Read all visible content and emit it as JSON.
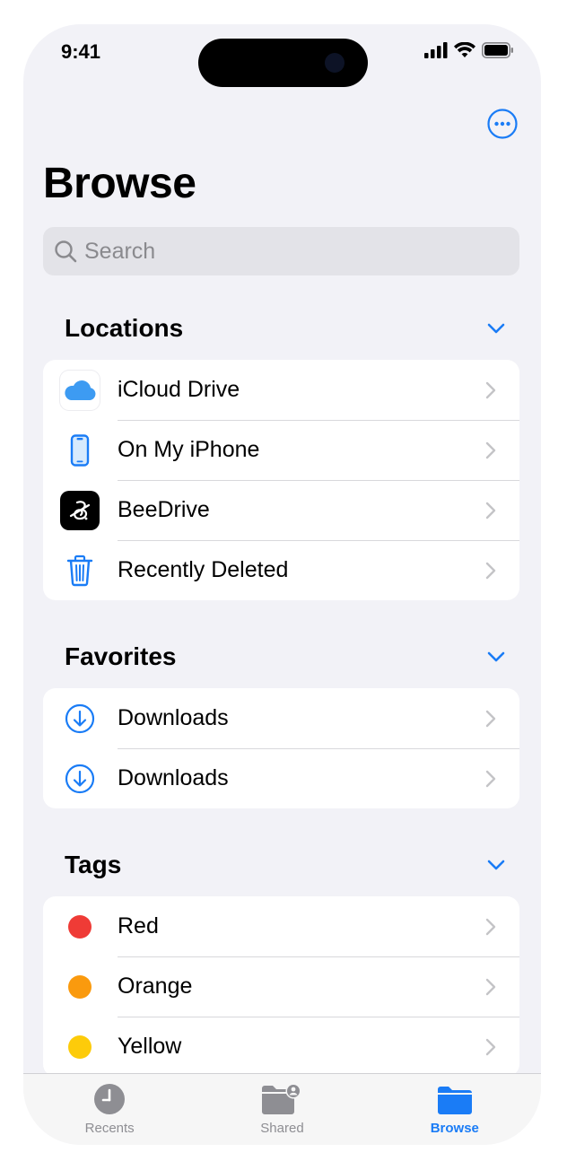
{
  "status_bar": {
    "time": "9:41"
  },
  "header": {
    "title": "Browse",
    "more_icon": "ellipsis-circle-icon"
  },
  "search": {
    "placeholder": "Search"
  },
  "sections": {
    "locations": {
      "title": "Locations",
      "items": [
        {
          "label": "iCloud Drive",
          "icon": "icloud-icon"
        },
        {
          "label": "On My iPhone",
          "icon": "iphone-icon"
        },
        {
          "label": "BeeDrive",
          "icon": "beedrive-icon"
        },
        {
          "label": "Recently Deleted",
          "icon": "trash-icon"
        }
      ]
    },
    "favorites": {
      "title": "Favorites",
      "items": [
        {
          "label": "Downloads",
          "icon": "download-circle-icon"
        },
        {
          "label": "Downloads",
          "icon": "download-circle-icon"
        }
      ]
    },
    "tags": {
      "title": "Tags",
      "items": [
        {
          "label": "Red",
          "color": "#ef3b36"
        },
        {
          "label": "Orange",
          "color": "#fa9a0e"
        },
        {
          "label": "Yellow",
          "color": "#fdcb0a"
        }
      ]
    }
  },
  "tab_bar": {
    "tabs": [
      {
        "label": "Recents",
        "icon": "clock-icon",
        "active": false
      },
      {
        "label": "Shared",
        "icon": "shared-folder-icon",
        "active": false
      },
      {
        "label": "Browse",
        "icon": "folder-icon",
        "active": true
      }
    ]
  },
  "colors": {
    "accent": "#1a7cf6",
    "background": "#f2f2f7"
  }
}
